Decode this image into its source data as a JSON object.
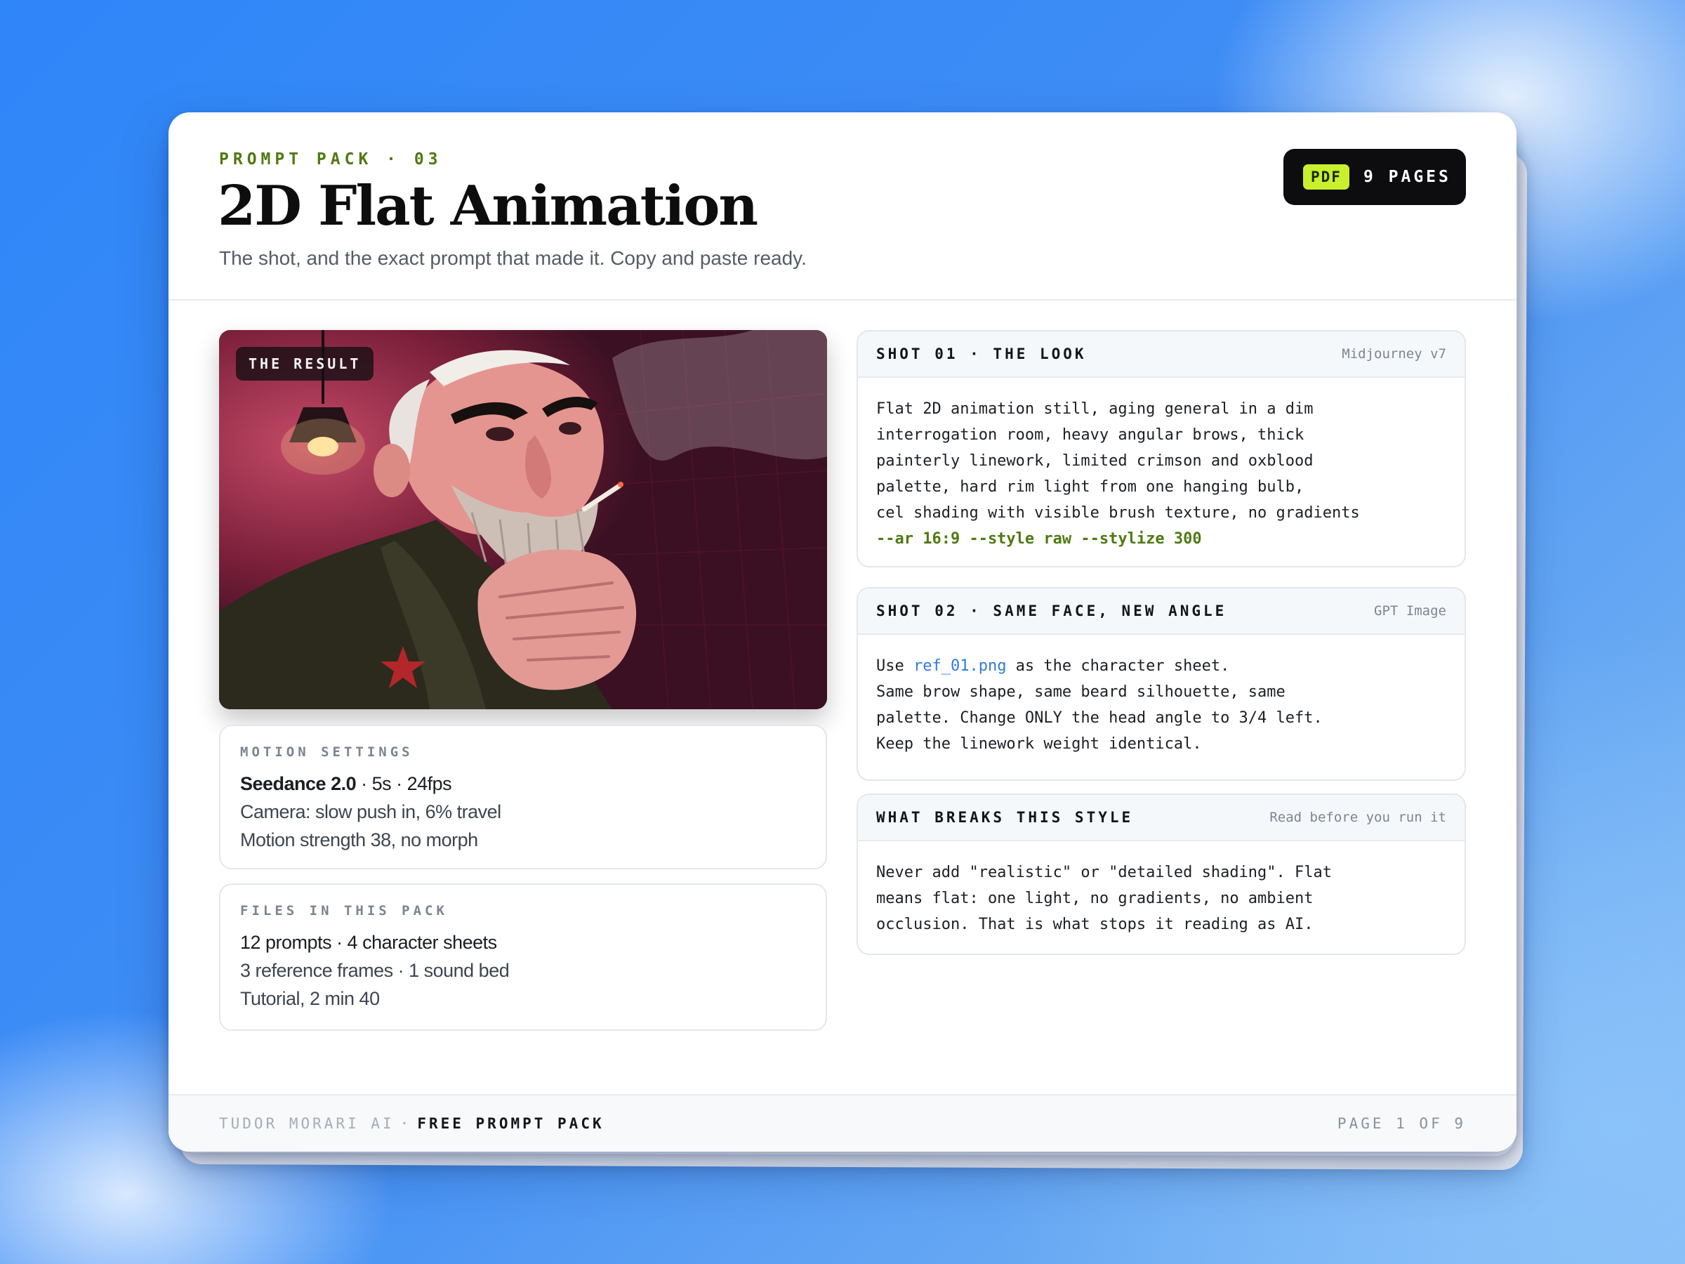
{
  "header": {
    "eyebrow": "PROMPT PACK · 03",
    "title": "2D Flat Animation",
    "subtitle": "The shot, and the exact prompt that made it. Copy and paste ready.",
    "badge": {
      "tag": "PDF",
      "pages": "9 PAGES"
    }
  },
  "hero": {
    "tag": "THE RESULT"
  },
  "motion": {
    "label": "MOTION SETTINGS",
    "model": "Seedance 2.0",
    "specs": " · 5s · 24fps",
    "line2": "Camera: slow push in, 6% travel",
    "line3": "Motion strength 38, no morph"
  },
  "files": {
    "label": "FILES IN THIS PACK",
    "line1": "12 prompts · 4 character sheets",
    "line2": "3 reference frames · 1 sound bed",
    "line3": "Tutorial, 2 min 40"
  },
  "shots": [
    {
      "title": "SHOT 01 · THE LOOK",
      "tool": "Midjourney v7",
      "lines": [
        "Flat 2D animation still, aging general in a dim",
        "interrogation room, heavy angular brows, thick",
        "painterly linework, limited crimson and oxblood",
        "palette, hard rim light from one hanging bulb,",
        "cel shading with visible brush texture, no gradients"
      ],
      "params": "--ar 16:9 --style raw --stylize 300"
    },
    {
      "title": "SHOT 02 · SAME FACE, NEW ANGLE",
      "tool": "GPT Image",
      "line1_pre": "Use ",
      "line1_file": "ref_01.png",
      "line1_post": " as the character sheet.",
      "lines": [
        "Same brow shape, same beard silhouette, same",
        "palette. Change ONLY the head angle to 3/4 left.",
        "Keep the linework weight identical."
      ]
    },
    {
      "title": "WHAT BREAKS THIS STYLE",
      "tool": "Read before you run it",
      "lines": [
        "Never add \"realistic\" or \"detailed shading\". Flat",
        "means flat: one light, no gradients, no ambient",
        "occlusion. That is what stops it reading as AI."
      ]
    }
  ],
  "footer": {
    "brand": "TUDOR MORARI AI",
    "separator": "·",
    "pack": "FREE PROMPT PACK",
    "page": "PAGE 1 OF 9"
  },
  "colors": {
    "accent_green": "#4f7a12",
    "badge_lime": "#c8f02c",
    "link_blue": "#2f7be0",
    "background_blue": "#2f86f8"
  }
}
